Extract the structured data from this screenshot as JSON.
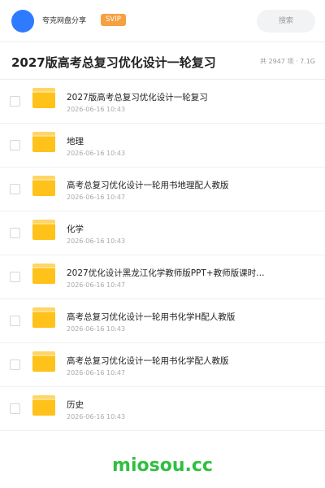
{
  "header": {
    "username": "夸克网盘分享",
    "badge": "SVIP",
    "search_placeholder": "搜索",
    "brand_color": "#2f7bff",
    "badge_color": "#f5a041"
  },
  "folder_title": "2027版高考总复习优化设计一轮复习",
  "folder_meta": "共 2947 项 · 7.1G",
  "items": [
    {
      "name": "2027版高考总复习优化设计一轮复习",
      "date": "2026-06-16 10:43",
      "icon": "folder-icon"
    },
    {
      "name": "地理",
      "date": "2026-06-16 10:43",
      "icon": "folder-icon"
    },
    {
      "name": "高考总复习优化设计一轮用书地理配人教版",
      "date": "2026-06-16 10:47",
      "icon": "folder-icon"
    },
    {
      "name": "化学",
      "date": "2026-06-16 10:43",
      "icon": "folder-icon"
    },
    {
      "name": "2027优化设计黑龙江化学教师版PPT+教师版课时…",
      "date": "2026-06-16 10:47",
      "icon": "folder-icon"
    },
    {
      "name": "高考总复习优化设计一轮用书化学H配人教版",
      "date": "2026-06-16 10:43",
      "icon": "folder-icon"
    },
    {
      "name": "高考总复习优化设计一轮用书化学配人教版",
      "date": "2026-06-16 10:47",
      "icon": "folder-icon"
    },
    {
      "name": "历史",
      "date": "2026-06-16 10:43",
      "icon": "folder-icon"
    }
  ],
  "watermark": "miosou.cc"
}
